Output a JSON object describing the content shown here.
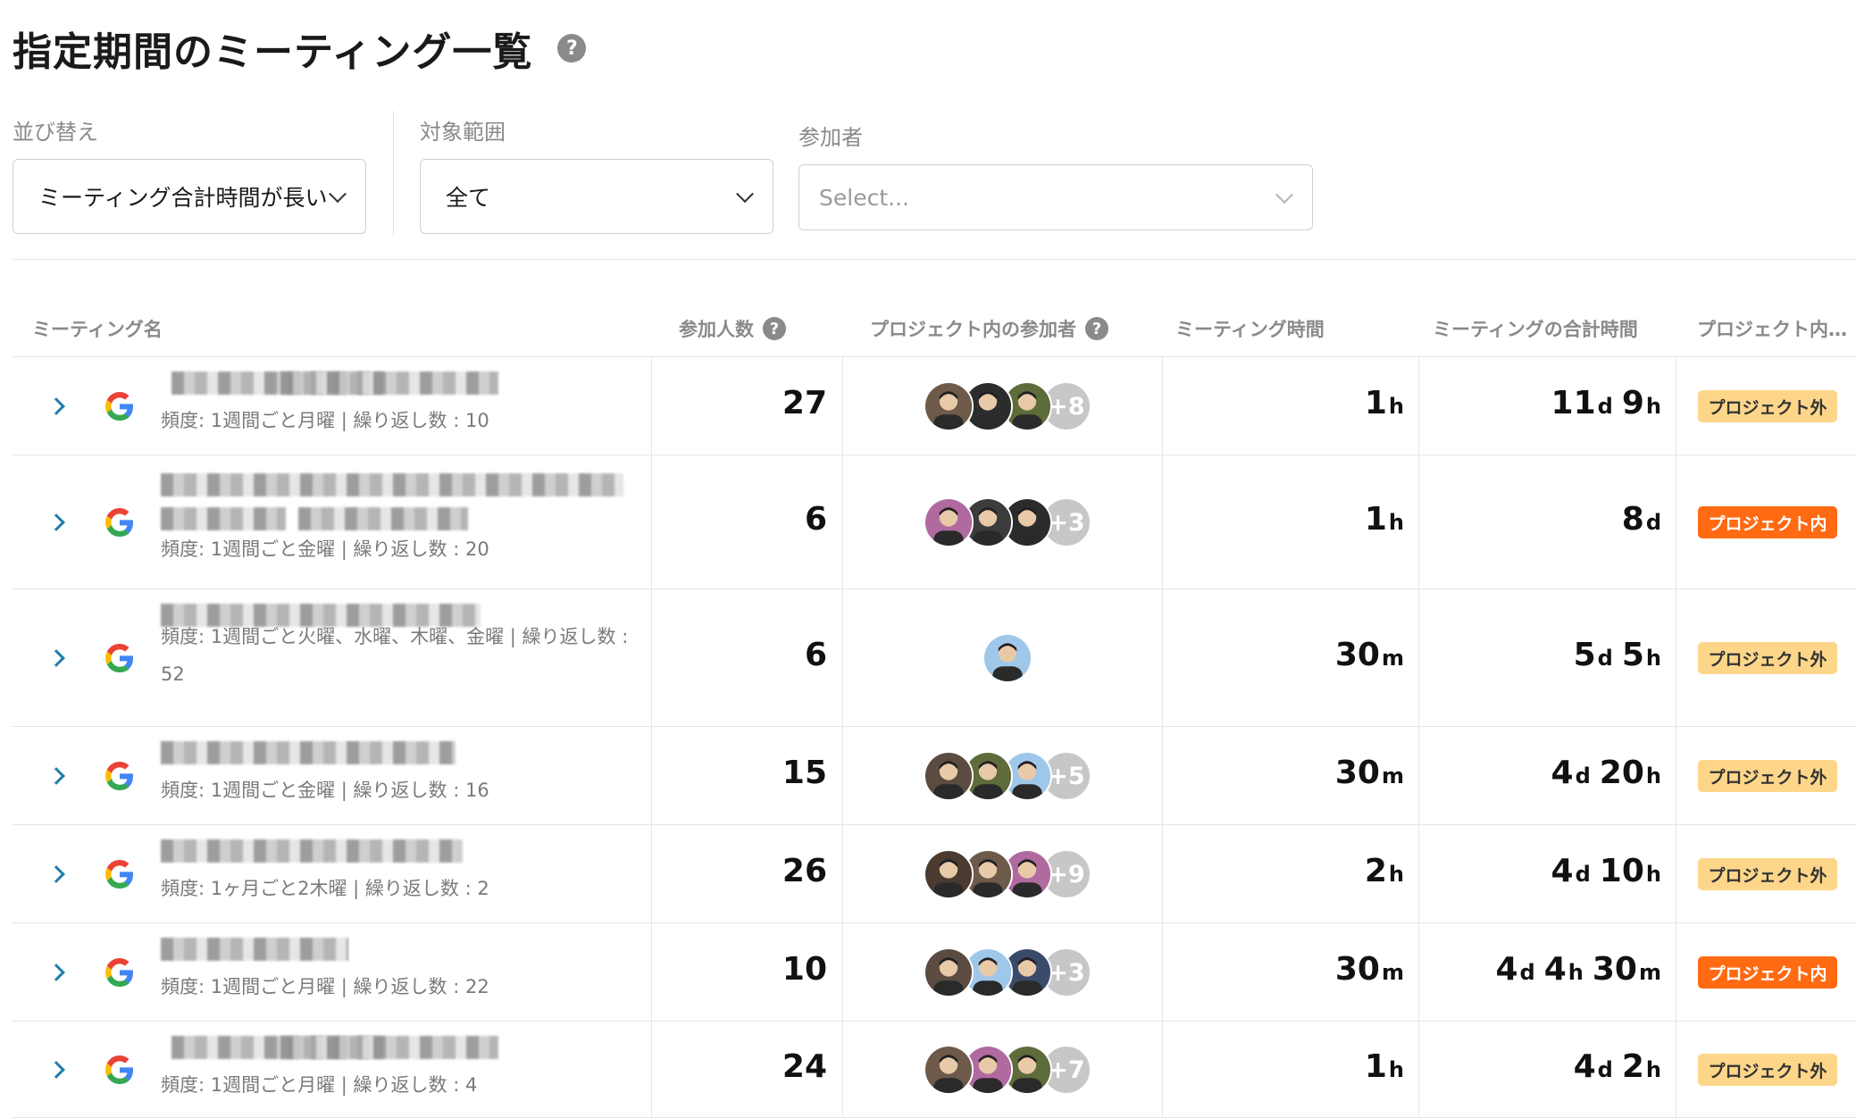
{
  "page_title": "指定期間のミーティング一覧",
  "filters": {
    "sort": {
      "label": "並び替え",
      "value": "ミーティング合計時間が長い"
    },
    "scope": {
      "label": "対象範囲",
      "value": "全て"
    },
    "participants": {
      "label": "参加者",
      "placeholder": "Select..."
    }
  },
  "table": {
    "columns": [
      "ミーティング名",
      "参加人数",
      "プロジェクト内の参加者",
      "ミーティング時間",
      "ミーティングの合計時間",
      "プロジェクト内…"
    ],
    "rows": [
      {
        "frequency": "頻度: 1週間ごと月曜 | 繰り返し数 : 10",
        "participants": "27",
        "more": "+8",
        "duration": [
          [
            "1",
            "h"
          ]
        ],
        "total": [
          [
            "11",
            "d"
          ],
          [
            "9",
            "h"
          ]
        ],
        "badge": "プロジェクト外",
        "badge_type": "out"
      },
      {
        "frequency": "頻度: 1週間ごと金曜 | 繰り返し数 : 20",
        "participants": "6",
        "more": "+3",
        "duration": [
          [
            "1",
            "h"
          ]
        ],
        "total": [
          [
            "8",
            "d"
          ]
        ],
        "badge": "プロジェクト内",
        "badge_type": "in"
      },
      {
        "frequency": "頻度: 1週間ごと火曜、水曜、木曜、金曜 | 繰り返し数 : 52",
        "participants": "6",
        "more": "",
        "duration": [
          [
            "30",
            "m"
          ]
        ],
        "total": [
          [
            "5",
            "d"
          ],
          [
            "5",
            "h"
          ]
        ],
        "badge": "プロジェクト外",
        "badge_type": "out"
      },
      {
        "frequency": "頻度: 1週間ごと金曜 | 繰り返し数 : 16",
        "participants": "15",
        "more": "+5",
        "duration": [
          [
            "30",
            "m"
          ]
        ],
        "total": [
          [
            "4",
            "d"
          ],
          [
            "20",
            "h"
          ]
        ],
        "badge": "プロジェクト外",
        "badge_type": "out"
      },
      {
        "frequency": "頻度: 1ヶ月ごと2木曜 | 繰り返し数 : 2",
        "participants": "26",
        "more": "+9",
        "duration": [
          [
            "2",
            "h"
          ]
        ],
        "total": [
          [
            "4",
            "d"
          ],
          [
            "10",
            "h"
          ]
        ],
        "badge": "プロジェクト外",
        "badge_type": "out"
      },
      {
        "frequency": "頻度: 1週間ごと月曜 | 繰り返し数 : 22",
        "participants": "10",
        "more": "+3",
        "duration": [
          [
            "30",
            "m"
          ]
        ],
        "total": [
          [
            "4",
            "d"
          ],
          [
            "4",
            "h"
          ],
          [
            "30",
            "m"
          ]
        ],
        "badge": "プロジェクト内",
        "badge_type": "in"
      },
      {
        "frequency": "頻度: 1週間ごと月曜 | 繰り返し数 : 4",
        "participants": "24",
        "more": "+7",
        "duration": [
          [
            "1",
            "h"
          ]
        ],
        "total": [
          [
            "4",
            "d"
          ],
          [
            "2",
            "h"
          ]
        ],
        "badge": "プロジェクト外",
        "badge_type": "out"
      }
    ]
  },
  "icons": {
    "help": "question-circle-icon",
    "expand": "chevron-right-icon",
    "calendar_source": "google-icon",
    "dropdown": "chevron-down-icon"
  },
  "colors": {
    "badge_out": "#fdd68a",
    "badge_in": "#ff6a13",
    "expand_arrow": "#1e7fa8"
  }
}
